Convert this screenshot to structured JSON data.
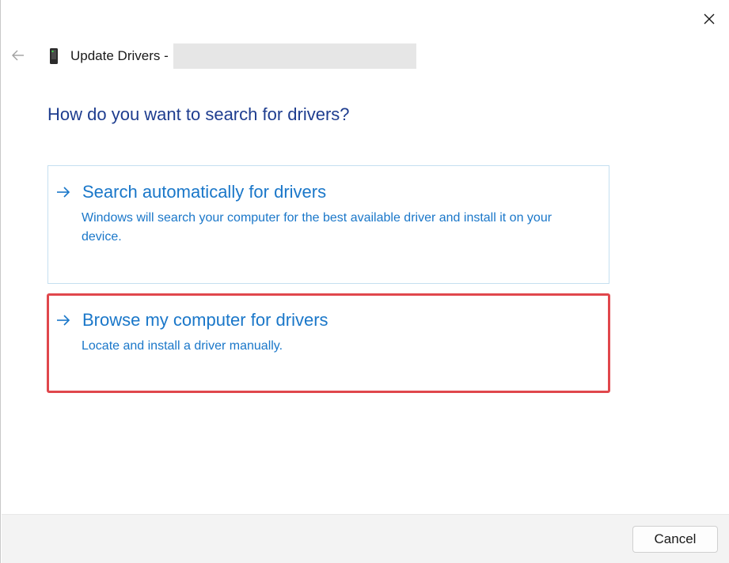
{
  "window": {
    "title": "Update Drivers - ",
    "close_icon": "close-icon",
    "back_icon": "back-arrow-icon",
    "device_icon": "device-icon"
  },
  "main": {
    "heading": "How do you want to search for drivers?",
    "options": [
      {
        "icon": "arrow-right-icon",
        "title": "Search automatically for drivers",
        "description": "Windows will search your computer for the best available driver and install it on your device."
      },
      {
        "icon": "arrow-right-icon",
        "title": "Browse my computer for drivers",
        "description": "Locate and install a driver manually.",
        "highlighted": true
      }
    ]
  },
  "footer": {
    "cancel_label": "Cancel"
  },
  "colors": {
    "heading": "#1e3d8f",
    "link": "#1a77c9",
    "highlight_border": "#e0474c",
    "option_border": "#c5dff0",
    "footer_bg": "#f3f3f3"
  }
}
